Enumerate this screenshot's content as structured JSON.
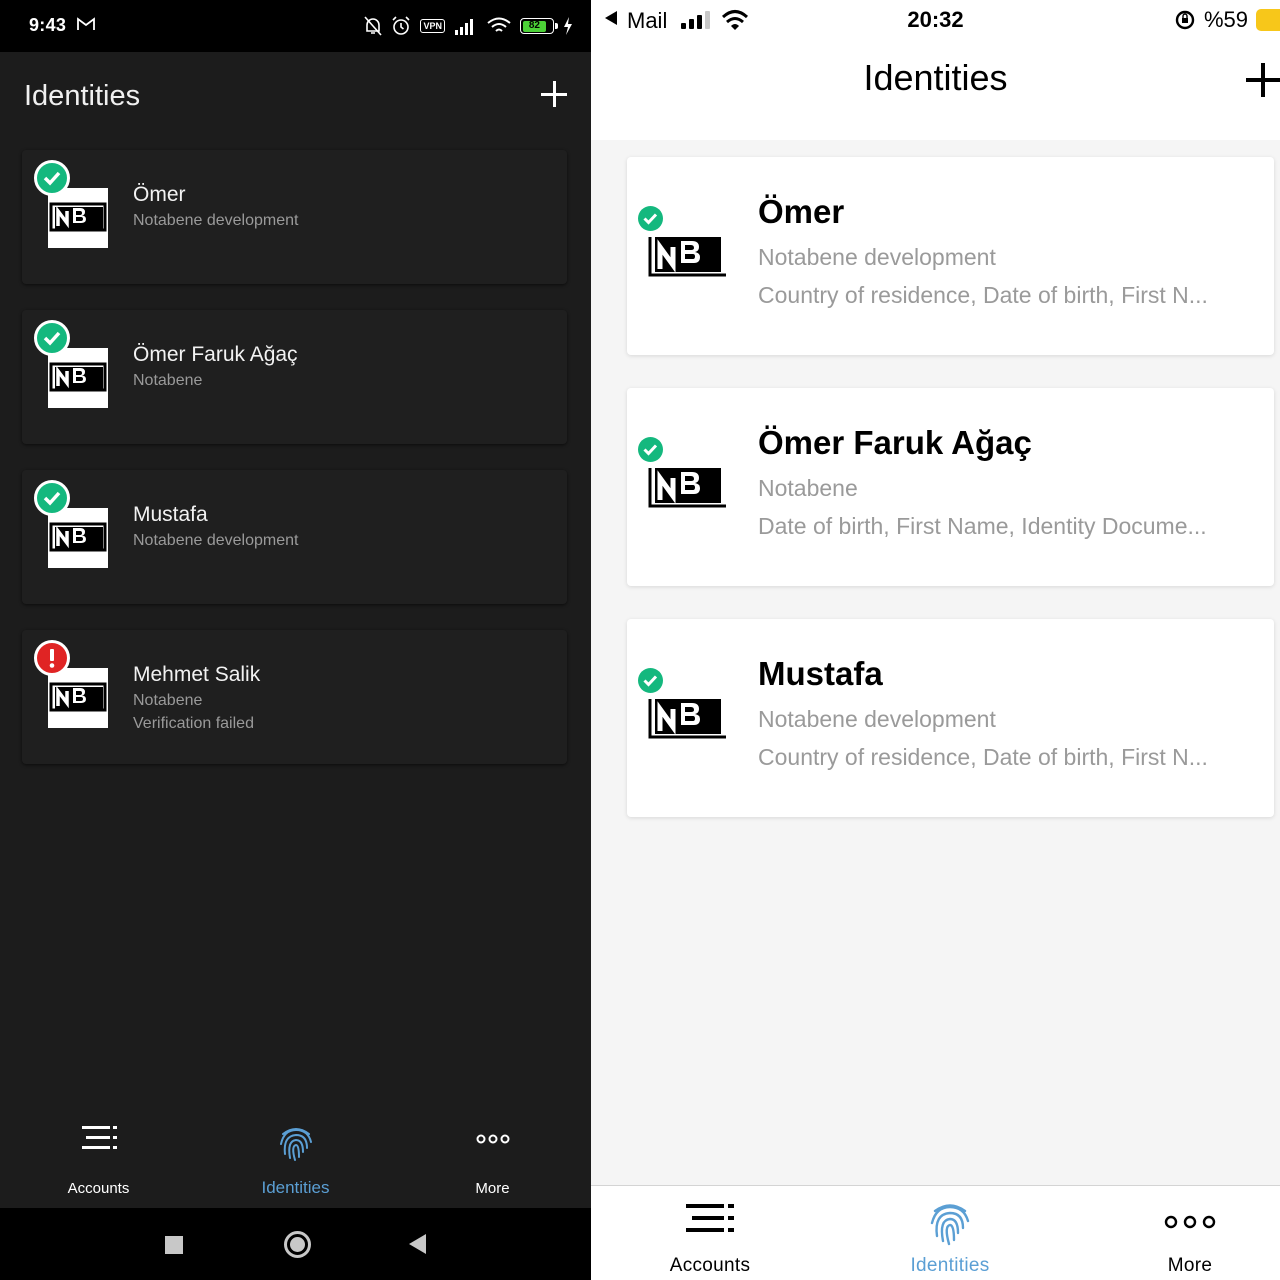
{
  "android": {
    "status_bar": {
      "time": "9:43",
      "vpn": "VPN",
      "battery": "82"
    },
    "header": {
      "title": "Identities"
    },
    "identities": [
      {
        "name": "Ömer",
        "org": "Notabene development",
        "extra": "",
        "status": "verified"
      },
      {
        "name": "Ömer Faruk Ağaç",
        "org": "Notabene",
        "extra": "",
        "status": "verified"
      },
      {
        "name": "Mustafa",
        "org": "Notabene development",
        "extra": "",
        "status": "verified"
      },
      {
        "name": "Mehmet Salik",
        "org": "Notabene",
        "extra": "Verification failed",
        "status": "failed"
      }
    ],
    "tabs": [
      {
        "label": "Accounts",
        "icon": "accounts-icon"
      },
      {
        "label": "Identities",
        "icon": "fingerprint-icon",
        "active": true
      },
      {
        "label": "More",
        "icon": "more-icon"
      }
    ],
    "nav_bar": [
      "recents-button",
      "home-button",
      "back-button"
    ]
  },
  "ios": {
    "status_bar": {
      "back_app": "Mail",
      "time": "20:32",
      "battery": "%59"
    },
    "header": {
      "title": "Identities"
    },
    "identities": [
      {
        "name": "Ömer",
        "org": "Notabene development",
        "fields": "Country of residence, Date of birth, First N...",
        "status": "verified"
      },
      {
        "name": "Ömer Faruk Ağaç",
        "org": "Notabene",
        "fields": "Date of birth, First Name, Identity Docume...",
        "status": "verified"
      },
      {
        "name": "Mustafa",
        "org": "Notabene development",
        "fields": "Country of residence, Date of birth, First N...",
        "status": "verified"
      }
    ],
    "tabs": [
      {
        "label": "Accounts",
        "icon": "accounts-icon"
      },
      {
        "label": "Identities",
        "icon": "fingerprint-icon",
        "active": true
      },
      {
        "label": "More",
        "icon": "more-icon"
      }
    ]
  },
  "colors": {
    "verified": "#14b87e",
    "failed": "#e02424",
    "active_tab": "#5b9fd4",
    "android_bg": "#1c1c1c",
    "ios_bg": "#f5f5f5"
  }
}
